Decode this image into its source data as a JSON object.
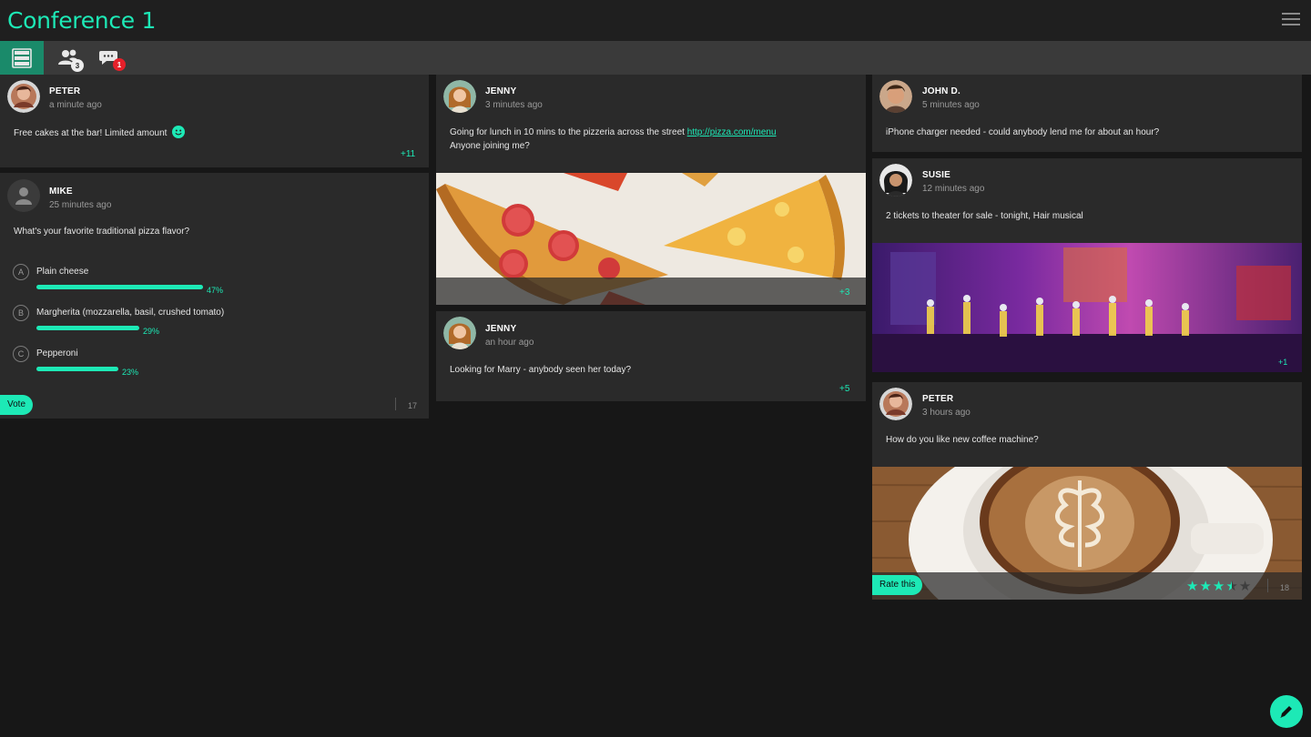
{
  "app": {
    "title": "Conference 1",
    "accent": "#1de9b6"
  },
  "tabs": [
    {
      "icon": "feed-icon",
      "badge": ""
    },
    {
      "icon": "people-icon",
      "badge": "3"
    },
    {
      "icon": "chat-icon",
      "badge": "1"
    }
  ],
  "posts": {
    "peter_cakes": {
      "author": "PETER",
      "time": "a minute ago",
      "text": "Free cakes at the bar! Limited amount",
      "count": "+11"
    },
    "mike_poll": {
      "author": "MIKE",
      "time": "25 minutes ago",
      "text": "What's your favorite traditional pizza flavor?",
      "options": [
        {
          "letter": "A",
          "label": "Plain cheese",
          "percent": "47%",
          "fraction": 0.47
        },
        {
          "letter": "B",
          "label": "Margherita (mozzarella, basil, crushed tomato)",
          "percent": "29%",
          "fraction": 0.29
        },
        {
          "letter": "C",
          "label": "Pepperoni",
          "percent": "23%",
          "fraction": 0.23
        }
      ],
      "vote_label": "Vote",
      "count": "17"
    },
    "jenny_lunch": {
      "author": "JENNY",
      "time": "3 minutes ago",
      "text_before": "Going for lunch in 10 mins to the pizzeria across the street ",
      "link": "http://pizza.com/menu",
      "text_line2": "Anyone joining me?",
      "count": "+3"
    },
    "jenny_marry": {
      "author": "JENNY",
      "time": "an hour ago",
      "text": "Looking for Marry - anybody seen her today?",
      "count": "+5"
    },
    "john_charger": {
      "author": "JOHN D.",
      "time": "5 minutes ago",
      "text": "iPhone charger needed - could anybody lend me for about an hour?"
    },
    "susie_tickets": {
      "author": "SUSIE",
      "time": "12 minutes ago",
      "text": "2 tickets to theater for sale - tonight, Hair musical",
      "count": "+1"
    },
    "peter_coffee": {
      "author": "PETER",
      "time": "3 hours ago",
      "text": "How do you like new coffee machine?",
      "rate_label": "Rate this",
      "rating": 3.5,
      "rating_max": 5,
      "count": "18"
    }
  }
}
